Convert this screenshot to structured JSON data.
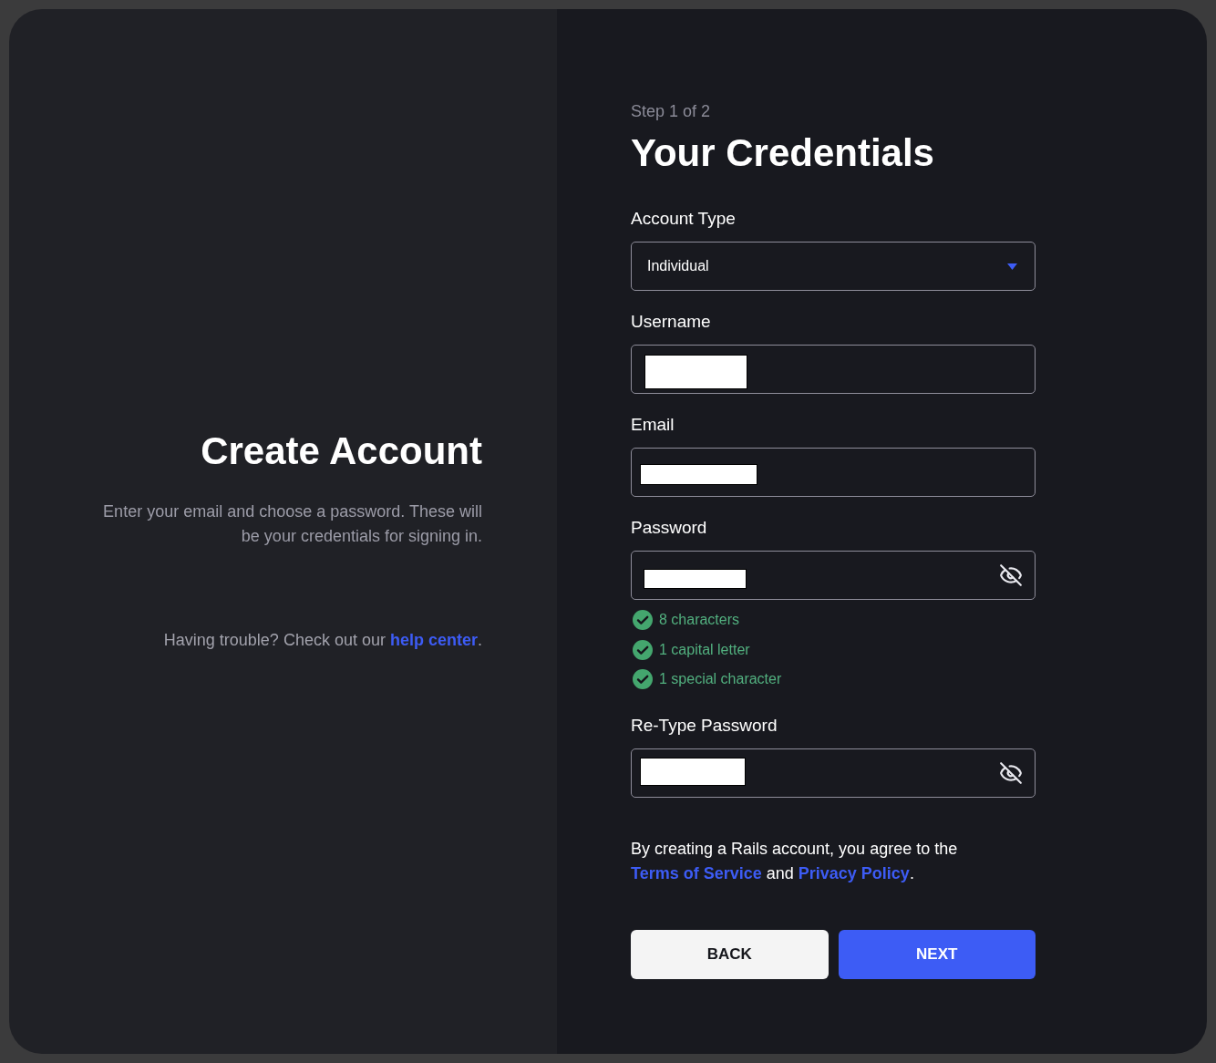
{
  "left_panel": {
    "title": "Create Account",
    "description": "Enter your email and choose a password. These will be your credentials for signing in.",
    "help": {
      "before": "Having trouble? Check out our ",
      "link": "help center",
      "after": "."
    }
  },
  "form": {
    "step": "Step 1 of 2",
    "title": "Your Credentials",
    "fields": [
      {
        "kind": "select",
        "label": "Account Type",
        "value": "Individual"
      },
      {
        "kind": "text",
        "label": "Username",
        "redacted": true
      },
      {
        "kind": "text",
        "label": "Email",
        "redacted": true
      },
      {
        "kind": "password",
        "label": "Password",
        "redacted": true,
        "password_visible": false,
        "requirements": [
          {
            "text": "8 characters",
            "met": true
          },
          {
            "text": "1 capital letter",
            "met": true
          },
          {
            "text": "1 special character",
            "met": true
          }
        ]
      },
      {
        "kind": "password",
        "label": "Re-Type Password",
        "redacted": true,
        "password_visible": false
      }
    ],
    "terms": {
      "before": "By creating a Rails account, you agree to the ",
      "terms_link": "Terms of Service",
      "middle": " and ",
      "privacy_link": "Privacy Policy",
      "after": "."
    },
    "buttons": [
      {
        "kind": "secondary",
        "label": "BACK"
      },
      {
        "kind": "primary",
        "label": "NEXT"
      }
    ]
  }
}
